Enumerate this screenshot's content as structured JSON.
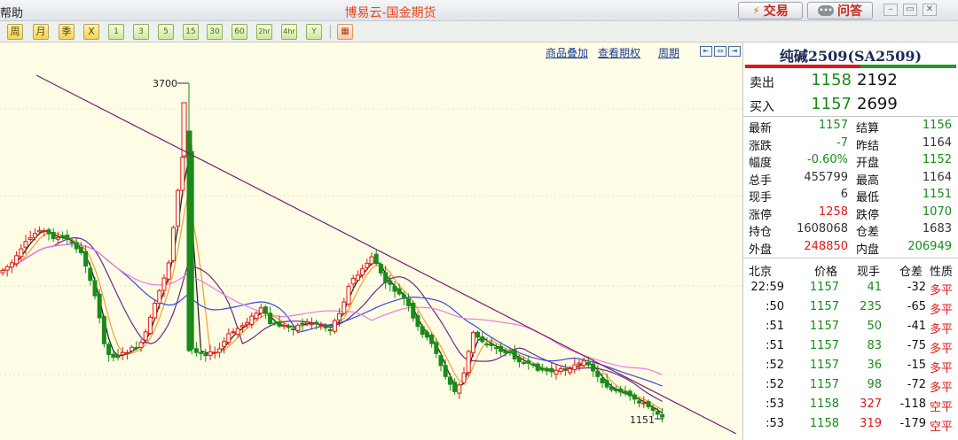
{
  "window": {
    "menu_help": "帮助",
    "title": "博易云-国金期货",
    "trade_label": "交易",
    "qa_label": "问答"
  },
  "toolbar": {
    "period_buttons": [
      "周",
      "月",
      "季",
      "X"
    ],
    "minute_buttons": [
      "1",
      "3",
      "5",
      "15",
      "30",
      "60",
      "2hr",
      "4hr",
      "Y"
    ]
  },
  "chart_links": {
    "overlay": "商品叠加",
    "options": "查看期权",
    "period": "周期"
  },
  "chart_data": {
    "type": "candlestick",
    "annotations": {
      "high_label": "3700",
      "low_label": "1151"
    },
    "y_range_approx": [
      1100,
      3750
    ],
    "indicators": [
      "moving average lines",
      "descending trend line"
    ],
    "colors": {
      "up": "#e01818",
      "down": "#1a8a1a",
      "background": "#fffde6",
      "trendline": "#7a1f6e"
    }
  },
  "quote": {
    "contract": "纯碱2509(SA2509)",
    "ask": {
      "label": "卖出",
      "price": "1158",
      "volume": "2192"
    },
    "bid": {
      "label": "买入",
      "price": "1157",
      "volume": "2699"
    },
    "rows": [
      {
        "l1": "最新",
        "v1": "1157",
        "c1": "green",
        "l2": "结算",
        "v2": "1156",
        "c2": "green"
      },
      {
        "l1": "涨跌",
        "v1": "-7",
        "c1": "green",
        "l2": "昨结",
        "v2": "1164",
        "c2": "dark"
      },
      {
        "l1": "幅度",
        "v1": "-0.60%",
        "c1": "green",
        "l2": "开盘",
        "v2": "1152",
        "c2": "green"
      },
      {
        "l1": "总手",
        "v1": "455799",
        "c1": "dark",
        "l2": "最高",
        "v2": "1164",
        "c2": "dark"
      },
      {
        "l1": "现手",
        "v1": "6",
        "c1": "dark",
        "l2": "最低",
        "v2": "1151",
        "c2": "green"
      },
      {
        "l1": "涨停",
        "v1": "1258",
        "c1": "red",
        "l2": "跌停",
        "v2": "1070",
        "c2": "green"
      },
      {
        "l1": "持仓",
        "v1": "1608068",
        "c1": "dark",
        "l2": "仓差",
        "v2": "1683",
        "c2": "dark"
      },
      {
        "l1": "外盘",
        "v1": "248850",
        "c1": "red",
        "l2": "内盘",
        "v2": "206949",
        "c2": "green"
      }
    ],
    "trades_header": {
      "time": "北京",
      "price": "价格",
      "volume": "现手",
      "oi": "仓差",
      "nature": "性质"
    },
    "trades": [
      {
        "time": "22:59",
        "price": "1157",
        "vol": "41",
        "vol_color": "green",
        "oi": "-32",
        "nature": "多平",
        "nature_color": "red"
      },
      {
        "time": ":50",
        "price": "1157",
        "vol": "235",
        "vol_color": "green",
        "oi": "-65",
        "nature": "多平",
        "nature_color": "red"
      },
      {
        "time": ":51",
        "price": "1157",
        "vol": "50",
        "vol_color": "green",
        "oi": "-41",
        "nature": "多平",
        "nature_color": "red"
      },
      {
        "time": ":51",
        "price": "1157",
        "vol": "83",
        "vol_color": "green",
        "oi": "-75",
        "nature": "多平",
        "nature_color": "red"
      },
      {
        "time": ":52",
        "price": "1157",
        "vol": "36",
        "vol_color": "green",
        "oi": "-15",
        "nature": "多平",
        "nature_color": "red"
      },
      {
        "time": ":52",
        "price": "1157",
        "vol": "98",
        "vol_color": "green",
        "oi": "-72",
        "nature": "多平",
        "nature_color": "red"
      },
      {
        "time": ":53",
        "price": "1158",
        "vol": "327",
        "vol_color": "red",
        "oi": "-118",
        "nature": "空平",
        "nature_color": "red"
      },
      {
        "time": ":53",
        "price": "1158",
        "vol": "319",
        "vol_color": "red",
        "oi": "-179",
        "nature": "空平",
        "nature_color": "red"
      }
    ]
  }
}
